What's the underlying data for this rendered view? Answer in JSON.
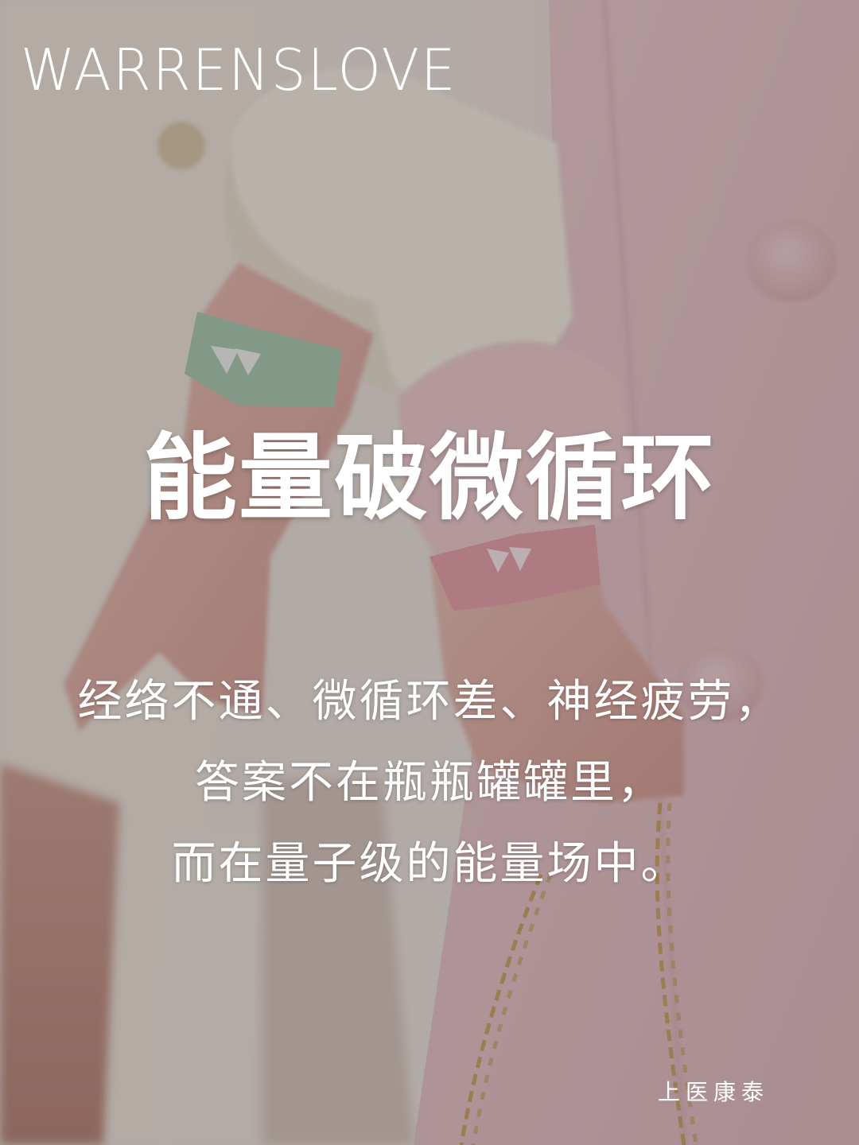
{
  "brand": {
    "wordmark": "WARRENSLOVE"
  },
  "headline": "能量破微循环",
  "body": {
    "lines": [
      "经络不通、微循环差、神经疲劳，",
      "答案不在瓶瓶罐罐里，",
      "而在量子级的能量场中。"
    ]
  },
  "signature": "上医康泰",
  "photo": {
    "description_icons": [
      "wristband-mint-icon",
      "wristband-pink-icon",
      "chain-strap-icon"
    ],
    "colors": {
      "coat_pink": "#e8c8cc",
      "sleeve_cream": "#f4efe2",
      "band_mint": "#a9cdb2",
      "band_pink": "#e9a3ad",
      "skin": "#e6b8ad",
      "chain_gold": "#c9a25a",
      "text": "#ffffff"
    }
  }
}
